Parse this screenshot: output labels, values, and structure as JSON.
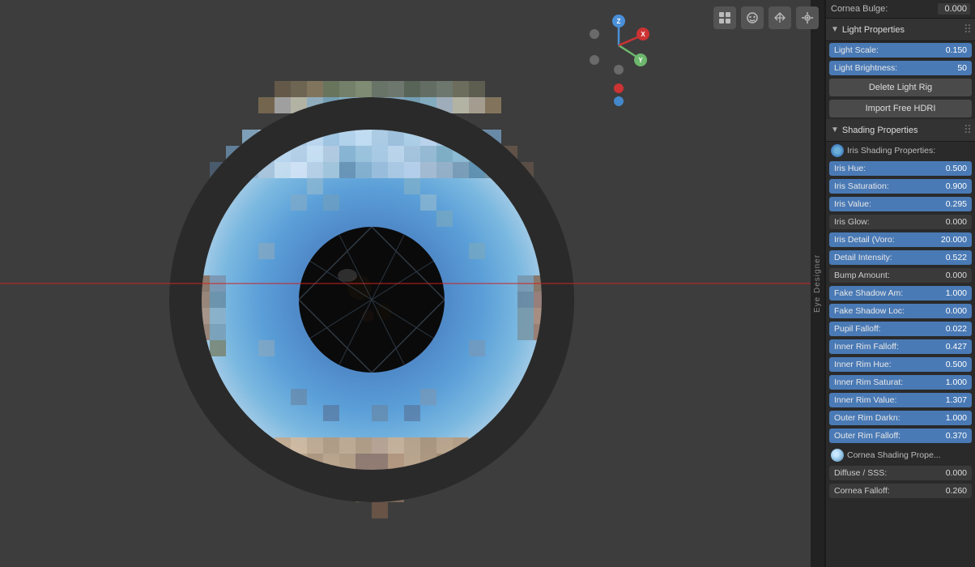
{
  "viewport": {
    "toolbar_icons": [
      "grid",
      "face",
      "hand",
      "snap"
    ],
    "red_line": true
  },
  "gizmo": {
    "z_label": "Z",
    "y_label": "Y",
    "x_label": "X",
    "z_color": "#4a90d9",
    "y_color": "#6db86d",
    "x_color": "#cc3333",
    "dot_red": {
      "color": "#cc3333"
    },
    "dot_blue": {
      "color": "#4488cc"
    }
  },
  "panel": {
    "cornea_bulge": {
      "label": "Cornea Bulge:",
      "value": "0.000"
    },
    "light_properties": {
      "title": "Light Properties",
      "collapsed": false,
      "properties": [
        {
          "label": "Light Scale:",
          "value": "0.150",
          "blue": true
        },
        {
          "label": "Light Brightness:",
          "value": "50",
          "blue": true
        }
      ],
      "buttons": [
        {
          "label": "Delete Light Rig"
        },
        {
          "label": "Import Free HDRI"
        }
      ]
    },
    "shading_properties": {
      "title": "Shading Properties",
      "collapsed": false,
      "iris_header": "Iris Shading Properties:",
      "properties": [
        {
          "label": "Iris Hue:",
          "value": "0.500",
          "blue": true
        },
        {
          "label": "Iris Saturation:",
          "value": "0.900",
          "blue": true
        },
        {
          "label": "Iris Value:",
          "value": "0.295",
          "blue": true
        },
        {
          "label": "Iris Glow:",
          "value": "0.000",
          "blue": false
        },
        {
          "label": "Iris Detail (Voro:",
          "value": "20.000",
          "blue": true
        },
        {
          "label": "Detail Intensity:",
          "value": "0.522",
          "blue": true
        },
        {
          "label": "Bump Amount:",
          "value": "0.000",
          "blue": false
        },
        {
          "label": "Fake Shadow Am:",
          "value": "1.000",
          "blue": true
        },
        {
          "label": "Fake Shadow Loc:",
          "value": "0.000",
          "blue": true
        },
        {
          "label": "Pupil Falloff:",
          "value": "0.022",
          "blue": true
        },
        {
          "label": "Inner Rim Falloff:",
          "value": "0.427",
          "blue": true
        },
        {
          "label": "Inner Rim Hue:",
          "value": "0.500",
          "blue": true
        },
        {
          "label": "Inner Rim Saturat:",
          "value": "1.000",
          "blue": true
        },
        {
          "label": "Inner Rim Value:",
          "value": "1.307",
          "blue": true
        },
        {
          "label": "Outer Rim Darkn:",
          "value": "1.000",
          "blue": true
        },
        {
          "label": "Outer Rim Falloff:",
          "value": "0.370",
          "blue": true
        }
      ],
      "cornea_header": "Cornea Shading Prope...",
      "cornea_properties": [
        {
          "label": "Diffuse / SSS:",
          "value": "0.000",
          "blue": false
        },
        {
          "label": "Cornea Falloff:",
          "value": "0.260",
          "blue": false
        }
      ]
    },
    "side_label": "Eye Designer"
  }
}
